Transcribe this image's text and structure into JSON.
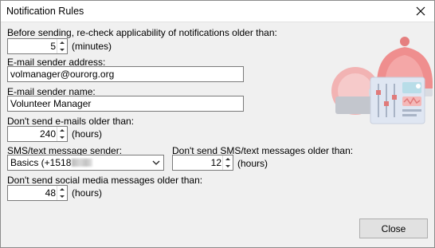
{
  "window": {
    "title": "Notification Rules"
  },
  "recheck": {
    "label": "Before sending, re-check applicability of notifications older than:",
    "value": "5",
    "unit": "(minutes)"
  },
  "email_sender_address": {
    "label": "E-mail sender address:",
    "value": "volmanager@ourorg.org"
  },
  "email_sender_name": {
    "label": "E-mail sender name:",
    "value": "Volunteer Manager"
  },
  "email_age": {
    "label": "Don't send e-mails older than:",
    "value": "240",
    "unit": "(hours)"
  },
  "sms_sender": {
    "label": "SMS/text message sender:",
    "value": "Basics (+1518"
  },
  "sms_age": {
    "label": "Don't send SMS/text messages older than:",
    "value": "12",
    "unit": "(hours)"
  },
  "social_age": {
    "label": "Don't send social media messages older than:",
    "value": "48",
    "unit": "(hours)"
  },
  "buttons": {
    "close": "Close"
  },
  "icons": {
    "close": "close-icon",
    "illustration": "notification-settings-illustration",
    "spin_up": "spin-up-arrow-icon",
    "spin_down": "spin-down-arrow-icon",
    "dropdown": "chevron-down-icon"
  },
  "colors": {
    "bell": "#ef8e8e",
    "panel": "#dfe6f2",
    "window_bg": "#f0f0f0"
  }
}
